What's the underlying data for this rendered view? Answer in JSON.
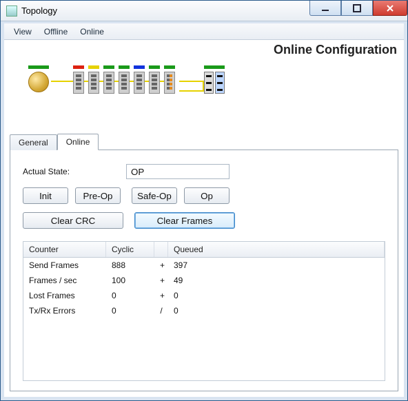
{
  "window": {
    "title": "Topology"
  },
  "menu": {
    "view": "View",
    "offline": "Offline",
    "online": "Online"
  },
  "header": {
    "title": "Online Configuration"
  },
  "tabs": {
    "general": "General",
    "online": "Online"
  },
  "online_panel": {
    "actual_state_label": "Actual State:",
    "actual_state_value": "OP",
    "buttons": {
      "init": "Init",
      "preop": "Pre-Op",
      "safeop": "Safe-Op",
      "op": "Op",
      "clear_crc": "Clear CRC",
      "clear_frames": "Clear Frames"
    },
    "table": {
      "headers": {
        "counter": "Counter",
        "cyclic": "Cyclic",
        "queued": "Queued"
      },
      "rows": [
        {
          "counter": "Send Frames",
          "cyclic": "888",
          "sep": "+",
          "queued": "397"
        },
        {
          "counter": "Frames / sec",
          "cyclic": "100",
          "sep": "+",
          "queued": "49"
        },
        {
          "counter": "Lost Frames",
          "cyclic": "0",
          "sep": "+",
          "queued": "0"
        },
        {
          "counter": "Tx/Rx Errors",
          "cyclic": "0",
          "sep": "/",
          "queued": "0"
        }
      ]
    }
  },
  "topology": {
    "master_status": "green",
    "slaves": [
      {
        "status": "red"
      },
      {
        "status": "yellow"
      },
      {
        "status": "green"
      },
      {
        "status": "green"
      },
      {
        "status": "blue"
      },
      {
        "status": "green"
      },
      {
        "status": "green",
        "variant": "orange"
      }
    ],
    "remote_status": "green"
  }
}
